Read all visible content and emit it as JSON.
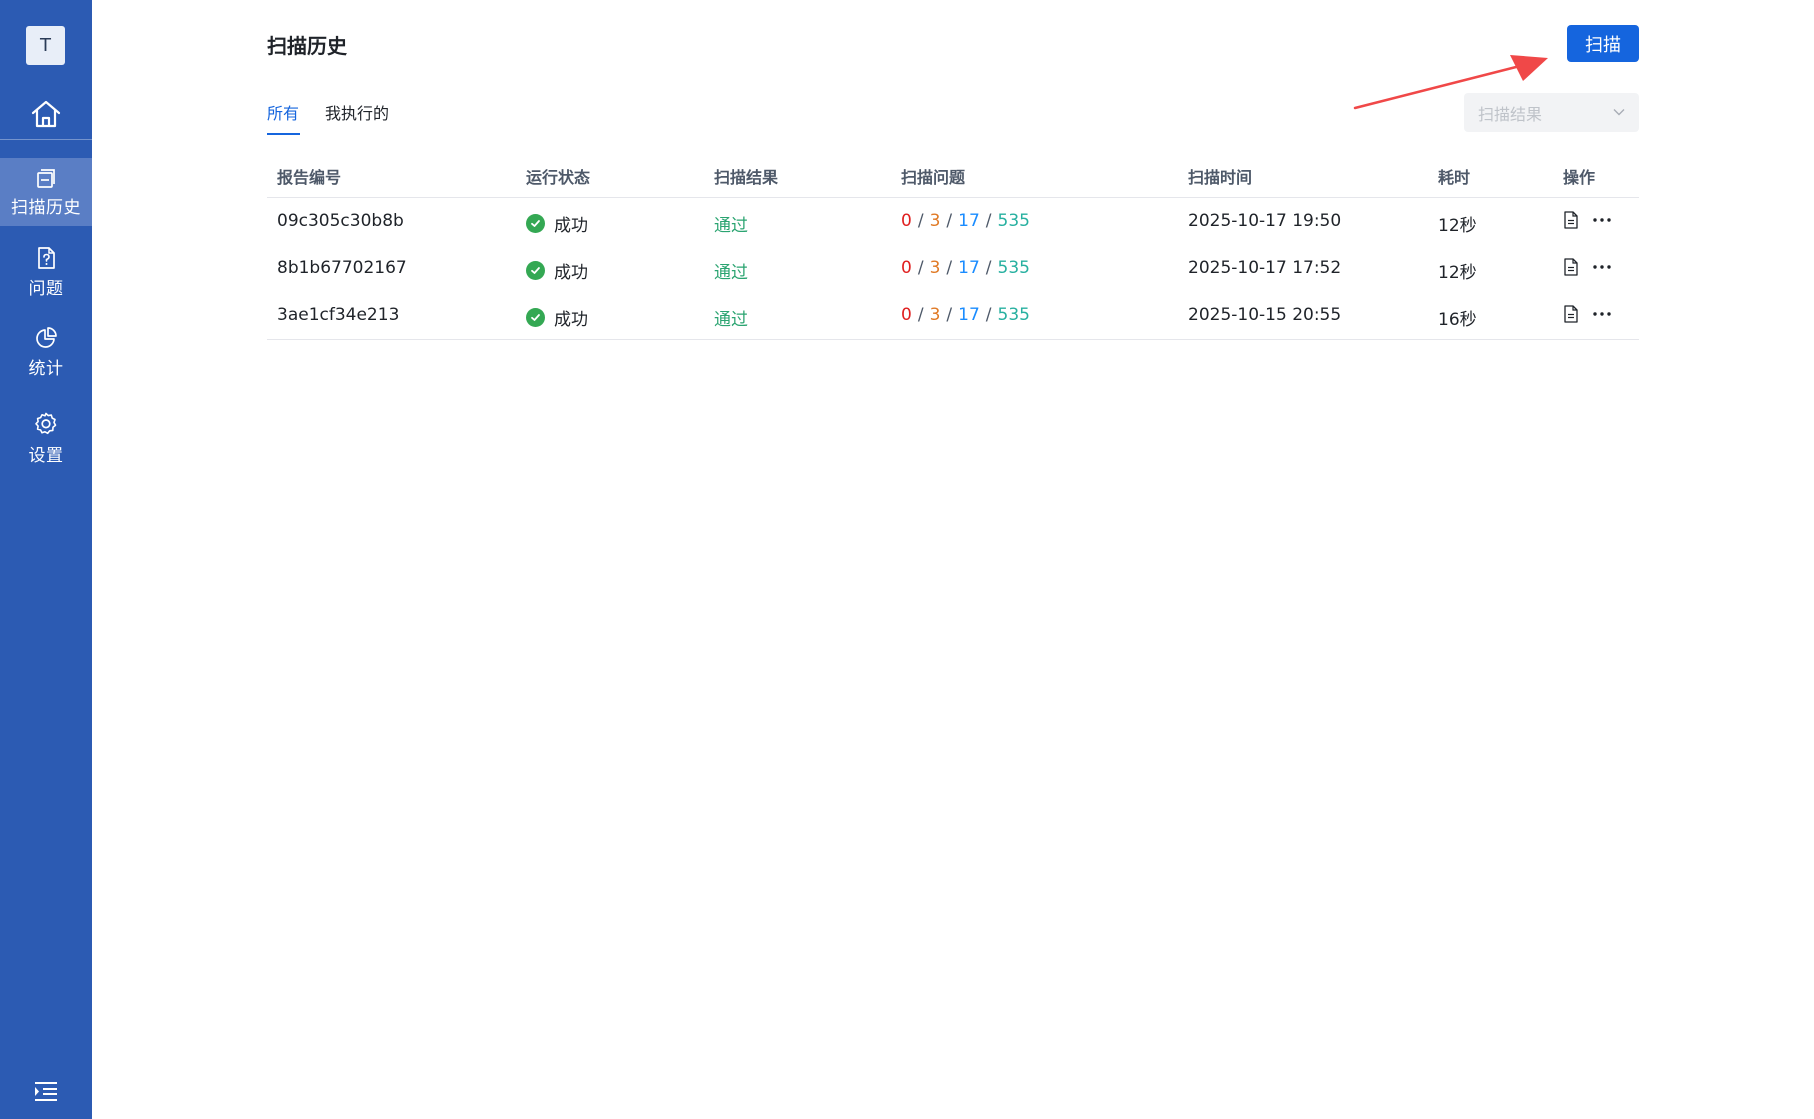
{
  "sidebar": {
    "avatar": "T",
    "items": [
      {
        "label": "扫描历史",
        "icon": "history-icon"
      },
      {
        "label": "问题",
        "icon": "issue-doc-icon"
      },
      {
        "label": "统计",
        "icon": "pie-chart-icon"
      },
      {
        "label": "设置",
        "icon": "gear-icon"
      }
    ],
    "active_index": 0
  },
  "page": {
    "title": "扫描历史",
    "scan_button": "扫描"
  },
  "tabs": [
    {
      "label": "所有",
      "active": true
    },
    {
      "label": "我执行的",
      "active": false
    }
  ],
  "filter": {
    "placeholder": "扫描结果"
  },
  "table": {
    "columns": [
      "报告编号",
      "运行状态",
      "扫描结果",
      "扫描问题",
      "扫描时间",
      "耗时",
      "操作"
    ],
    "rows": [
      {
        "id": "09c305c30b8b",
        "status": "成功",
        "result": "通过",
        "issues": {
          "critical": "0",
          "high": "3",
          "medium": "17",
          "low": "535"
        },
        "time": "2025-10-17 19:50",
        "duration": "12秒"
      },
      {
        "id": "8b1b67702167",
        "status": "成功",
        "result": "通过",
        "issues": {
          "critical": "0",
          "high": "3",
          "medium": "17",
          "low": "535"
        },
        "time": "2025-10-17 17:52",
        "duration": "12秒"
      },
      {
        "id": "3ae1cf34e213",
        "status": "成功",
        "result": "通过",
        "issues": {
          "critical": "0",
          "high": "3",
          "medium": "17",
          "low": "535"
        },
        "time": "2025-10-15 20:55",
        "duration": "16秒"
      }
    ],
    "issue_separator": "/"
  },
  "colors": {
    "sidebar": "#2c5bb3",
    "sidebar_active": "#5a7ec5",
    "primary": "#1565de",
    "success": "#34a853",
    "critical": "#e02020",
    "high": "#e07a26",
    "medium": "#1a8cff",
    "low": "#27b0a0",
    "annotation_arrow": "#f04848"
  }
}
